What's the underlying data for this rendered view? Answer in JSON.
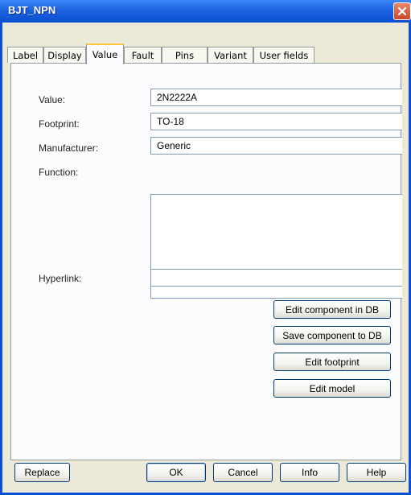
{
  "window": {
    "title": "BJT_NPN"
  },
  "tabs": [
    {
      "label": "Label"
    },
    {
      "label": "Display"
    },
    {
      "label": "Value"
    },
    {
      "label": "Fault"
    },
    {
      "label": "Pins"
    },
    {
      "label": "Variant"
    },
    {
      "label": "User fields"
    }
  ],
  "active_tab": "Value",
  "fields": {
    "value": {
      "label": "Value:",
      "value": "2N2222A"
    },
    "footprint": {
      "label": "Footprint:",
      "value": "TO-18"
    },
    "manufacturer": {
      "label": "Manufacturer:",
      "value": "Generic"
    },
    "function": {
      "label": "Function:",
      "value": ""
    },
    "hyperlink": {
      "label": "Hyperlink:",
      "value": ""
    }
  },
  "actions": {
    "edit_component_db": "Edit component in DB",
    "save_component_db": "Save component to DB",
    "edit_footprint": "Edit footprint",
    "edit_model": "Edit model"
  },
  "footer": {
    "replace": "Replace",
    "ok": "OK",
    "cancel": "Cancel",
    "info": "Info",
    "help": "Help"
  },
  "colors": {
    "titlebar": "#0b4fd0",
    "dialog_bg": "#ece9d8",
    "tab_highlight": "#ffc83c",
    "close_button": "#c9482a"
  }
}
